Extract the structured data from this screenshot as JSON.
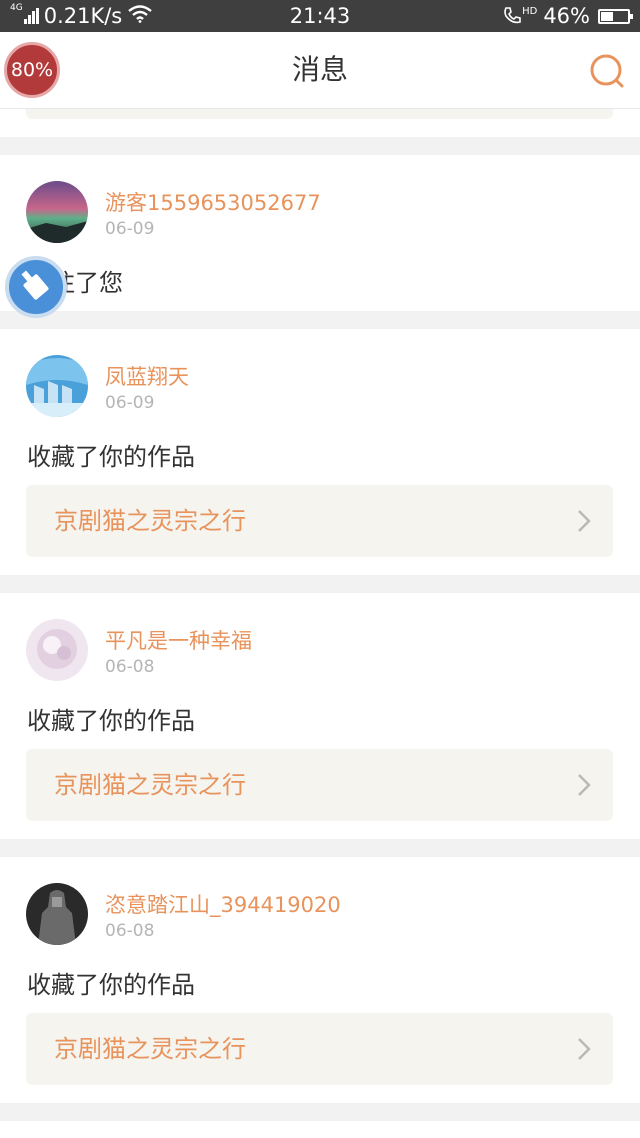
{
  "status_bar": {
    "network_type": "4G",
    "speed": "0.21K/s",
    "time": "21:43",
    "hd_label": "HD",
    "battery_text": "46%",
    "battery_level": 0.46
  },
  "header": {
    "title": "消息"
  },
  "float_badge": {
    "text": "80%"
  },
  "colors": {
    "accent": "#e8935c",
    "card_box": "#f5f4ef",
    "background": "#f2f2f2"
  },
  "messages": [
    {
      "username": "游客1559653052677",
      "date": "06-09",
      "action": "关注了您"
    },
    {
      "username": "凤蓝翔天",
      "date": "06-09",
      "action": "收藏了你的作品",
      "work_title": "京剧猫之灵宗之行"
    },
    {
      "username": "平凡是一种幸福",
      "date": "06-08",
      "action": "收藏了你的作品",
      "work_title": "京剧猫之灵宗之行"
    },
    {
      "username": "恣意踏江山_394419020",
      "date": "06-08",
      "action": "收藏了你的作品",
      "work_title": "京剧猫之灵宗之行"
    }
  ]
}
